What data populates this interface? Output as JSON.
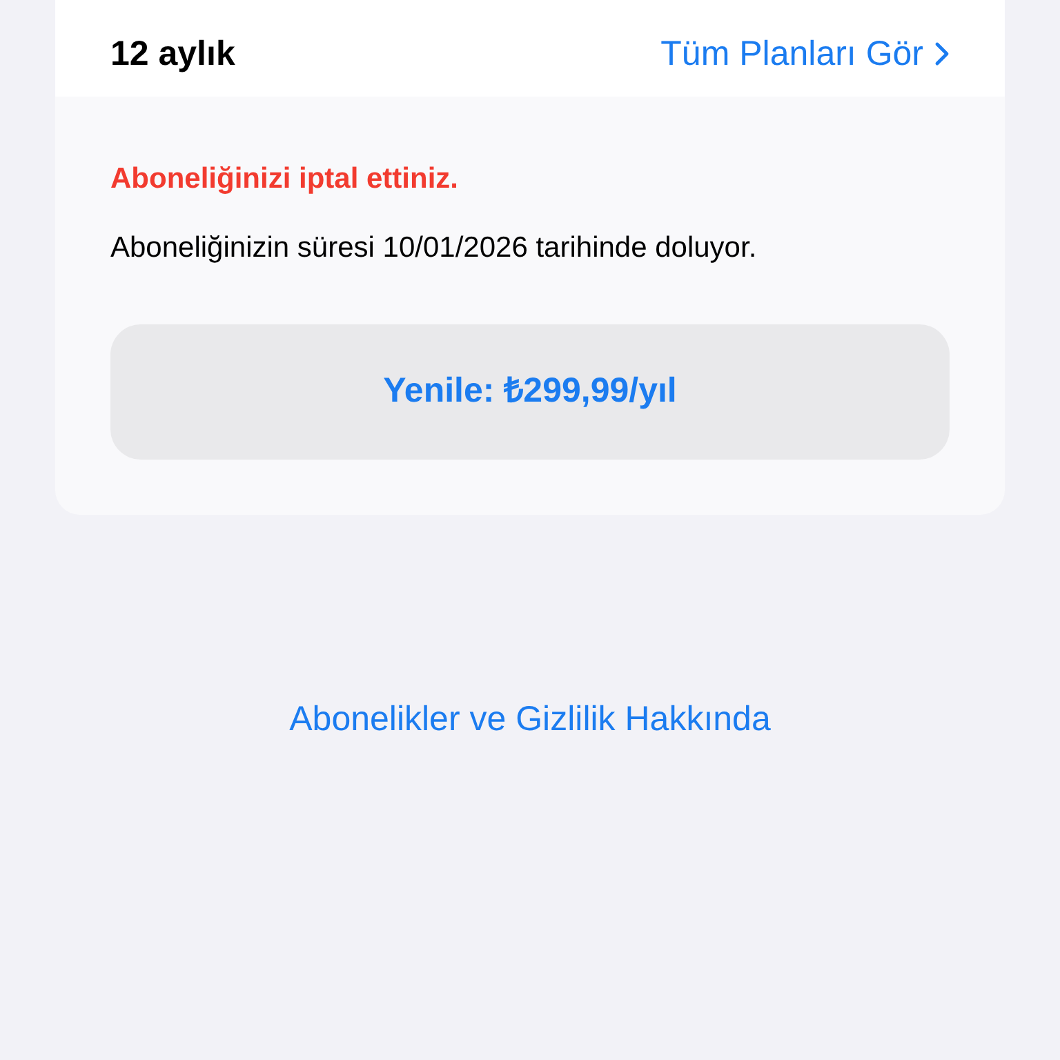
{
  "plan": {
    "title": "12 aylık",
    "link": "Tüm Planları Gör"
  },
  "status": {
    "alert": "Aboneliğinizi iptal ettiniz.",
    "message": "Aboneliğinizin süresi 10/01/2026 tarihinde doluyor."
  },
  "renew_button": {
    "label": "Yenile: ₺299,99/yıl"
  },
  "footer_link": "Abonelikler ve Gizlilik Hakkında"
}
